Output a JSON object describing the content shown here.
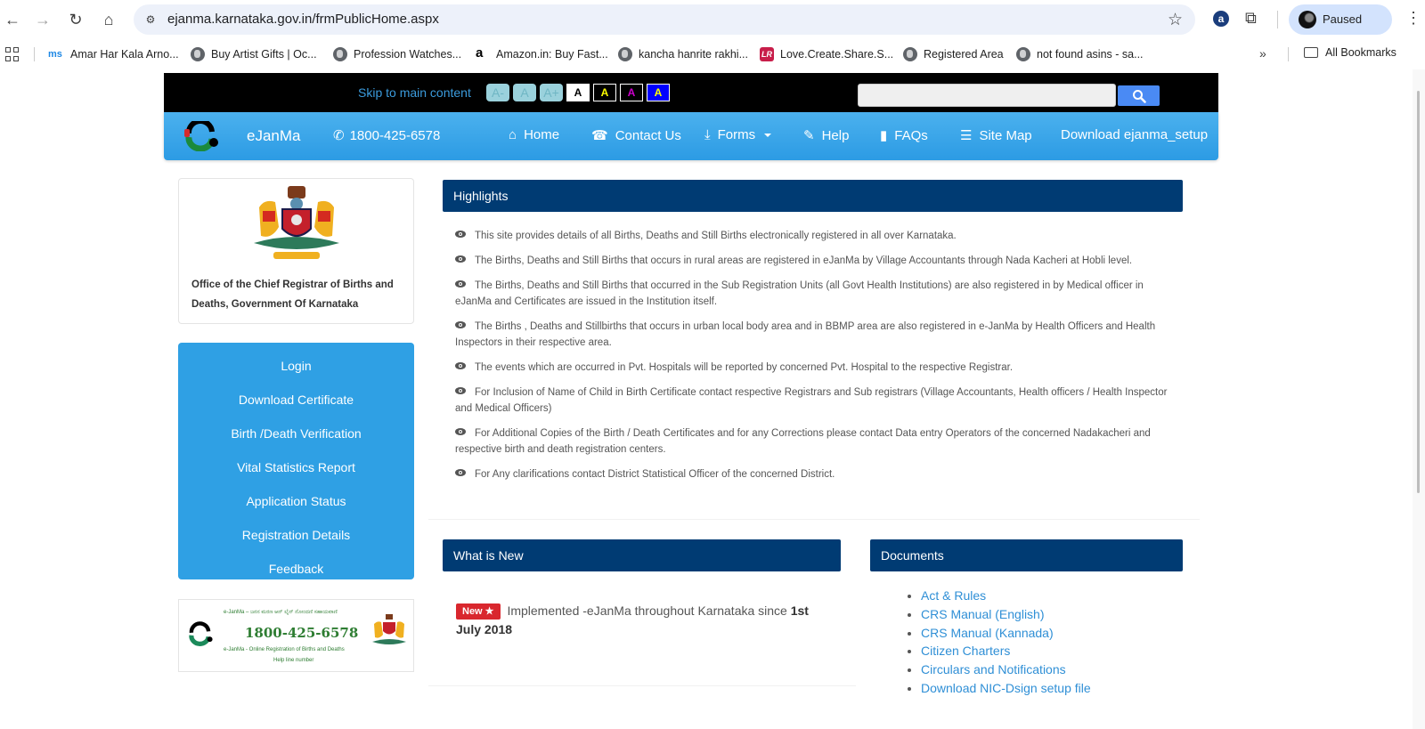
{
  "browser": {
    "url": "ejanma.karnataka.gov.in/frmPublicHome.aspx",
    "profile_status": "Paused",
    "bookmarks": [
      {
        "label": "Amar Har Kala Arno...",
        "icon": "ms-favicon"
      },
      {
        "label": "Buy Artist Gifts | Oc...",
        "icon": "globe-icon"
      },
      {
        "label": "Profession Watches...",
        "icon": "globe-icon"
      },
      {
        "label": "Amazon.in: Buy Fast...",
        "icon": "amazon-favicon"
      },
      {
        "label": "kancha hanrite rakhi...",
        "icon": "globe-icon"
      },
      {
        "label": "Love.Create.Share.S...",
        "icon": "lr-favicon"
      },
      {
        "label": "Registered Area",
        "icon": "globe-icon"
      },
      {
        "label": "not found asins - sa...",
        "icon": "globe-icon"
      }
    ],
    "bookmarks_overflow": "»",
    "all_bookmarks": "All Bookmarks"
  },
  "access_bar": {
    "skip_link": "Skip to main content",
    "font_buttons": [
      "A-",
      "A",
      "A+"
    ],
    "contrast_buttons": [
      {
        "label": "A",
        "bg": "#ffffff",
        "fg": "#000000"
      },
      {
        "label": "A",
        "bg": "#000000",
        "fg": "#ffff00"
      },
      {
        "label": "A",
        "bg": "#000000",
        "fg": "#cc00cc"
      },
      {
        "label": "A",
        "bg": "#0000ff",
        "fg": "#ffff00"
      }
    ],
    "search_value": "",
    "search_placeholder": ""
  },
  "navbar": {
    "brand": "eJanMa",
    "phone": "1800-425-6578",
    "items": [
      {
        "label": "Home",
        "icon": "home-icon"
      },
      {
        "label": "Contact Us",
        "icon": "phone-icon"
      },
      {
        "label": "Forms",
        "icon": "download-icon"
      },
      {
        "label": "Help",
        "icon": "pencil-icon"
      },
      {
        "label": "FAQs",
        "icon": "book-icon"
      },
      {
        "label": "Site Map",
        "icon": "list-icon"
      },
      {
        "label": "Download ejanma_setup",
        "icon": ""
      }
    ]
  },
  "office": {
    "title": "Office of the Chief Registrar of Births and Deaths, Government Of Karnataka"
  },
  "menu": [
    "Login",
    "Download Certificate",
    "Birth /Death Verification",
    "Vital Statistics Report",
    "Application Status",
    "Registration Details",
    "Feedback"
  ],
  "helpline_banner": {
    "kannada_line": "e-JanMa – ಜನನ ಮರಣ ಆನ್ ಲೈನ್ ನೋಂದಣಿ ಸಹಾಯವಾಣಿ",
    "number": "1800-425-6578",
    "english_line": "e-JanMa - Online Registration of Births and Deaths",
    "english_line2": "Help line number"
  },
  "highlights": {
    "title": "Highlights",
    "items": [
      "This site provides details of all Births, Deaths and Still Births electronically registered in all over Karnataka.",
      "The Births, Deaths and Still Births that occurs in rural areas are registered in eJanMa by Village Accountants through Nada Kacheri at Hobli level.",
      "The Births, Deaths and Still Births that occurred in the Sub Registration Units (all Govt Health Institutions) are also registered in by Medical officer in eJanMa and Certificates are issued in the Institution itself.",
      "The Births , Deaths and Stillbirths that occurs in urban local body area and in BBMP area are also registered in e-JanMa by Health Officers and Health Inspectors in their respective area.",
      "The events which are occurred in Pvt. Hospitals will be reported by concerned Pvt. Hospital to the respective Registrar.",
      "For Inclusion of Name of Child in Birth Certificate contact respective Registrars and Sub registrars (Village Accountants, Health officers / Health Inspector and Medical Officers)",
      "For Additional Copies of the Birth / Death Certificates and for any Corrections please contact Data entry Operators of the concerned Nadakacheri and respective birth and death registration centers.",
      "For Any clarifications contact District Statistical Officer of the concerned District."
    ]
  },
  "whats_new": {
    "title": "What is New",
    "badge": "New ★",
    "text": "Implemented -eJanMa throughout Karnataka since ",
    "bold_text": "1st July 2018"
  },
  "documents": {
    "title": "Documents",
    "items": [
      "Act & Rules",
      "CRS Manual (English)",
      "CRS Manual (Kannada)",
      "Citizen Charters",
      "Circulars and Notifications",
      "Download NIC-Dsign setup file"
    ]
  },
  "colors": {
    "panel_header": "#003b73",
    "nav_blue": "#2c9be4",
    "menu_blue": "#2fa0e4",
    "link_blue": "#2f8fd6",
    "badge_red": "#d9272e"
  }
}
